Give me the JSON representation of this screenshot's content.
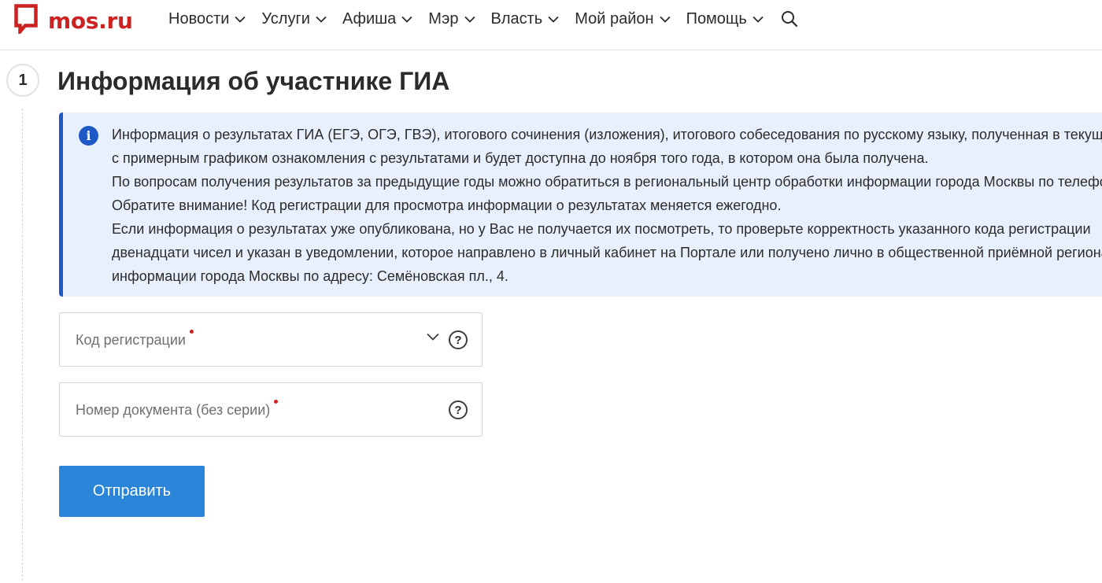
{
  "header": {
    "logo_text": "mos.ru",
    "brand_color": "#cc2222",
    "nav": [
      {
        "label": "Новости"
      },
      {
        "label": "Услуги"
      },
      {
        "label": "Афиша"
      },
      {
        "label": "Мэр"
      },
      {
        "label": "Власть"
      },
      {
        "label": "Мой район"
      },
      {
        "label": "Помощь"
      }
    ],
    "search_icon": "search-icon"
  },
  "step": {
    "number": "1",
    "title": "Информация об участнике ГИА"
  },
  "info": {
    "icon": "info-icon",
    "accent_color": "#1f59c6",
    "background_color": "#e9f0fd",
    "lines": [
      "Информация о результатах ГИА (ЕГЭ, ОГЭ, ГВЭ), итогового сочинения (изложения), итогового собеседования по русскому языку, полученная в текущем",
      "с примерным графиком ознакомления с результатами и будет доступна до ноября того года, в котором она была получена.",
      "По вопросам получения результатов за предыдущие годы можно обратиться в региональный центр обработки информации города Москвы по телефону",
      "Обратите внимание! Код регистрации для просмотра информации о результатах меняется ежегодно.",
      "Если информация о результатах уже опубликована, но у Вас не получается их посмотреть, то проверьте корректность указанного кода регистрации",
      "двенадцати чисел и указан в уведомлении, которое направлено в личный кабинет на Портале или получено лично в общественной приёмной регионального",
      "информации города Москвы по адресу: Семёновская пл., 4."
    ]
  },
  "form": {
    "registration_code": {
      "label": "Код регистрации",
      "required": true,
      "value": ""
    },
    "document_number": {
      "label": "Номер документа (без серии)",
      "required": true,
      "value": ""
    },
    "submit_label": "Отправить",
    "submit_color": "#2a85d8"
  }
}
